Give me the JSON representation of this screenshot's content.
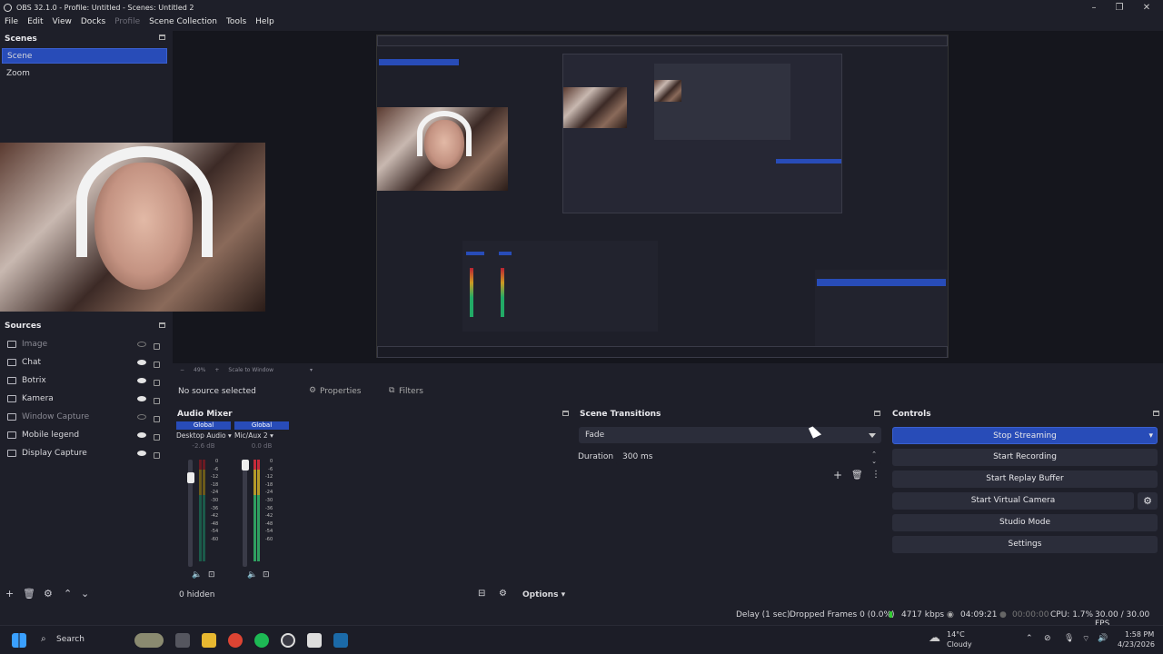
{
  "window": {
    "title": "OBS 32.1.0 - Profile: Untitled - Scenes: Untitled 2"
  },
  "menu": [
    "File",
    "Edit",
    "View",
    "Docks",
    "Profile",
    "Scene Collection",
    "Tools",
    "Help"
  ],
  "scenes": {
    "title": "Scenes",
    "items": [
      "Scene",
      "Zoom"
    ],
    "selected": "Scene"
  },
  "sources": {
    "title": "Sources",
    "items": [
      {
        "label": "Image",
        "visible": false
      },
      {
        "label": "Chat",
        "visible": true
      },
      {
        "label": "Botrix",
        "visible": true
      },
      {
        "label": "Kamera",
        "visible": true
      },
      {
        "label": "Window Capture",
        "visible": false
      },
      {
        "label": "Mobile legend",
        "visible": true
      },
      {
        "label": "Display Capture",
        "visible": true
      }
    ]
  },
  "props_bar": {
    "no_source": "No source selected",
    "properties": "Properties",
    "filters": "Filters"
  },
  "preview": {
    "zoom": "49%",
    "scale": "Scale to Window"
  },
  "mixer": {
    "title": "Audio Mixer",
    "channels": [
      {
        "scope": "Global",
        "name": "Desktop Audio",
        "db": "-2.6 dB",
        "level": 0.85
      },
      {
        "scope": "Global",
        "name": "Mic/Aux 2",
        "db": "0.0 dB",
        "level": 1.0
      }
    ],
    "scale": [
      "0",
      "-6",
      "-12",
      "-18",
      "-24",
      "-30",
      "-36",
      "-42",
      "-48",
      "-54",
      "-60"
    ],
    "hidden": "0 hidden",
    "options": "Options"
  },
  "transitions": {
    "title": "Scene Transitions",
    "selected": "Fade",
    "duration_label": "Duration",
    "duration": "300 ms"
  },
  "controls": {
    "title": "Controls",
    "buttons": [
      "Stop Streaming",
      "Start Recording",
      "Start Replay Buffer",
      "Start Virtual Camera",
      "Studio Mode",
      "Settings"
    ]
  },
  "status": {
    "delay": "Delay (1 sec)",
    "dropped": "Dropped Frames 0 (0.0%)",
    "kbps": "4717 kbps",
    "stream_time": "04:09:21",
    "rec_time": "00:00:00",
    "cpu": "CPU: 1.7%",
    "fps": "30.00 / 30.00 FPS"
  },
  "taskbar": {
    "search": "Search",
    "weather_temp": "14°C",
    "weather_text": "Cloudy",
    "time": "1:58 PM",
    "date": "4/23/2026"
  },
  "colors": {
    "accent": "#284cb8",
    "panel": "#1e1f29",
    "button": "#2b2d3a"
  }
}
